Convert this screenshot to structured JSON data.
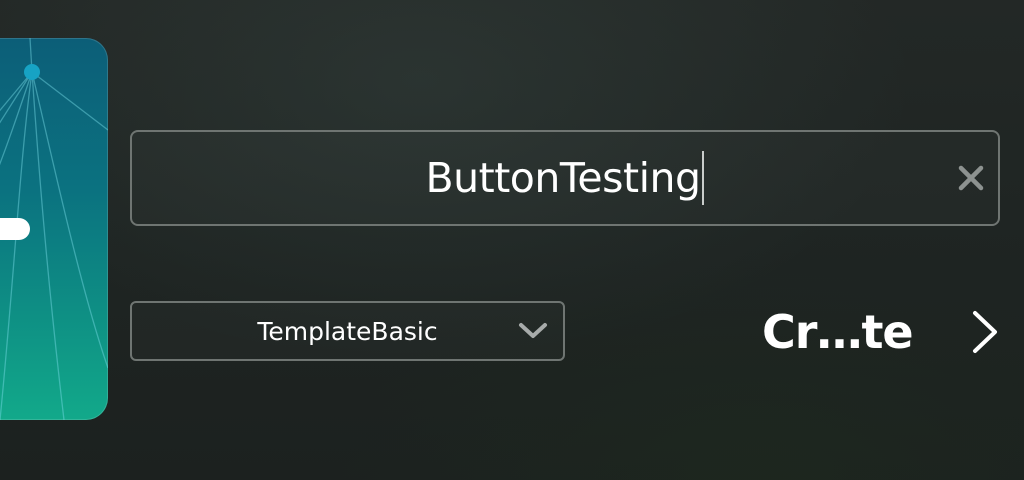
{
  "name_field": {
    "value": "ButtonTesting",
    "clear_icon": "close-icon"
  },
  "template_select": {
    "selected": "TemplateBasic",
    "icon": "chevron-down-icon"
  },
  "create_button": {
    "label": "Cr…te",
    "icon": "chevron-right-icon"
  },
  "preview_card": {
    "gradient_colors": [
      "#0c5e78",
      "#0e8f84",
      "#12a98a"
    ],
    "accent_node_color": "#17a3c4"
  },
  "colors": {
    "background": "#202624",
    "field_border": "#6f7572",
    "text": "#ffffff"
  }
}
